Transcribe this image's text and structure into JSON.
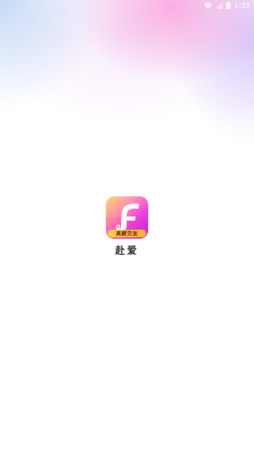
{
  "status_bar": {
    "time": "1:33",
    "icons": [
      "wifi-icon",
      "signal-icon",
      "battery-icon"
    ]
  },
  "splash": {
    "app_name": "赴爱",
    "logo_letter": "F",
    "logo_badge": "高颜交友"
  },
  "colors": {
    "logo_gradient_start": "#ffc83d",
    "logo_gradient_mid": "#f13fd6",
    "logo_gradient_end": "#b12bd6",
    "badge": "#ffc530",
    "app_name_text": "#222222"
  }
}
